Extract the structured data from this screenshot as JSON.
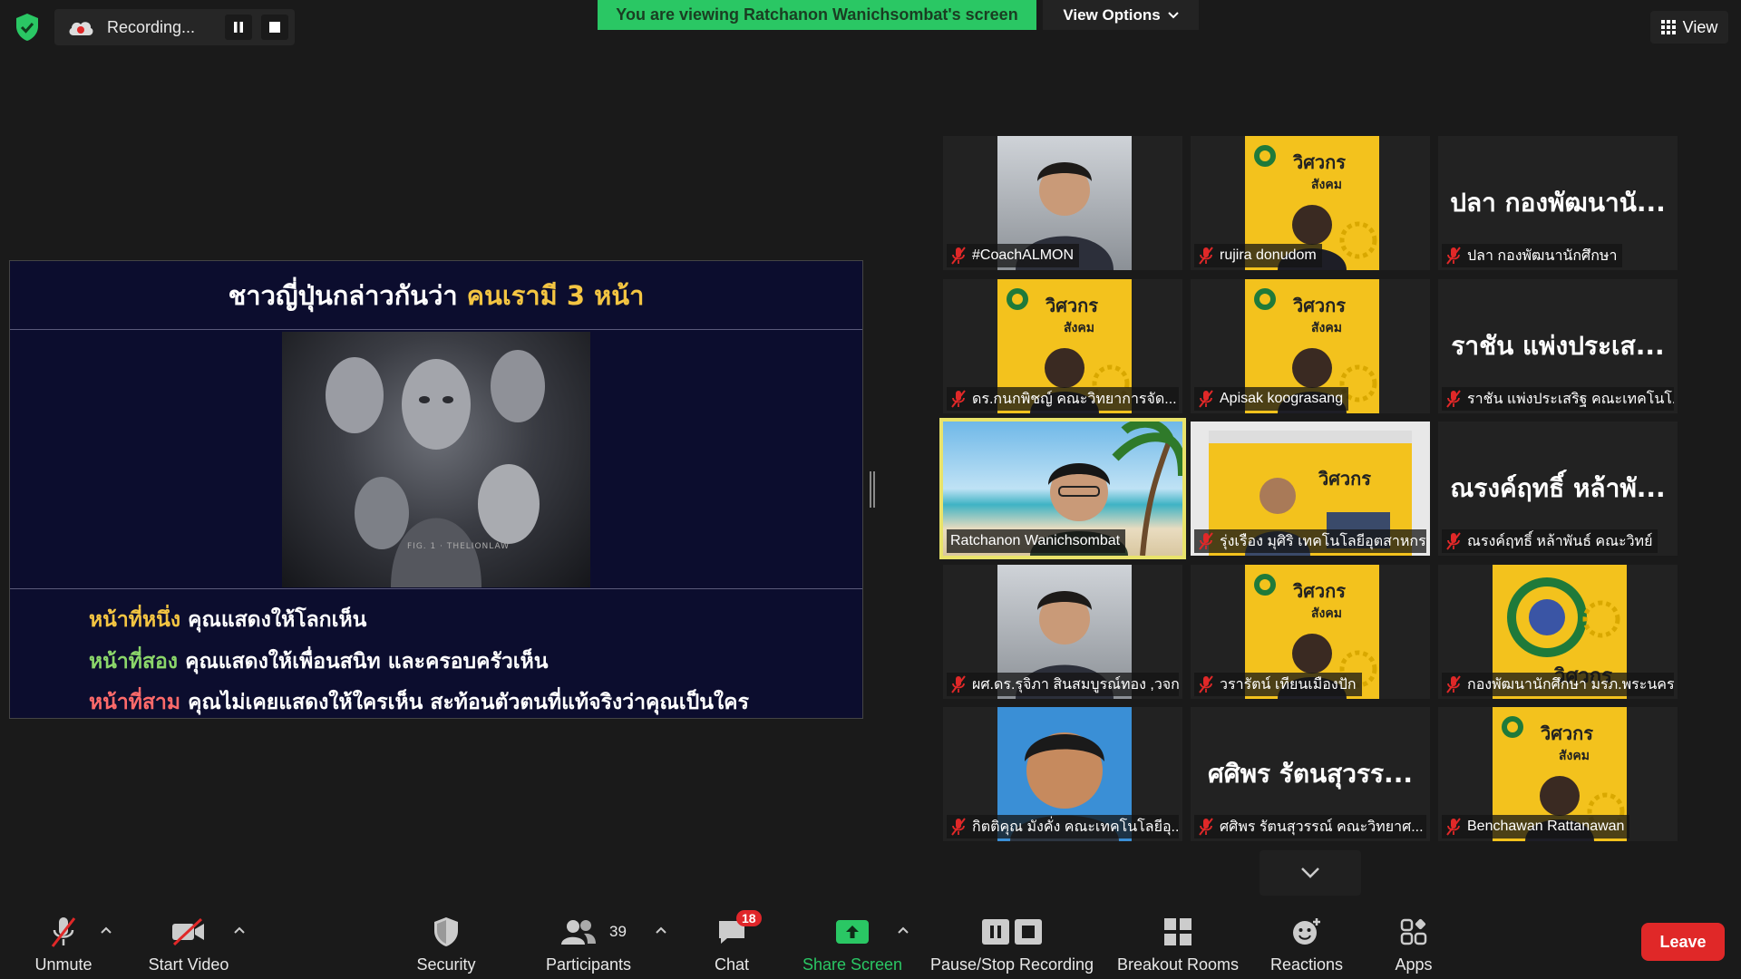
{
  "top_bar": {
    "recording_label": "Recording...",
    "viewing_banner": "You are viewing Ratchanon Wanichsombat's screen",
    "view_options_label": "View Options",
    "view_label": "View"
  },
  "shared_screen": {
    "title_main": "ชาวญี่ปุ่นกล่าวกันว่า",
    "title_highlight": "คนเรามี 3 หน้า",
    "lines": [
      {
        "highlight": "หน้าที่หนึ่ง",
        "text": "คุณแสดงให้โลกเห็น"
      },
      {
        "highlight": "หน้าที่สอง",
        "text": "คุณแสดงให้เพื่อนสนิท และครอบครัวเห็น"
      },
      {
        "highlight": "หน้าที่สาม",
        "text": "คุณไม่เคยแสดงให้ใครเห็น สะท้อนตัวตนที่แท้จริงว่าคุณเป็นใคร"
      }
    ],
    "image_watermark": "FIG. 1 · THELIONLAW"
  },
  "gallery": [
    {
      "name": "#CoachALMON",
      "video": "photo",
      "muted": true
    },
    {
      "name": "rujira donudom",
      "video": "poster",
      "muted": true
    },
    {
      "name": "ปลา กองพัฒนานักศึกษา",
      "big_name": "ปลา กองพัฒนานั...",
      "video": "none",
      "muted": true
    },
    {
      "name": "ดร.กนกพิชญ์ คณะวิทยาการจัด...",
      "video": "poster",
      "muted": true
    },
    {
      "name": "Apisak koograsang",
      "video": "poster",
      "muted": true
    },
    {
      "name": "ราชัน แพ่งประเสริฐ คณะเทคโนโ...",
      "big_name": "ราชัน แพ่งประเส...",
      "video": "none",
      "muted": true
    },
    {
      "name": "Ratchanon Wanichsombat",
      "video": "beach",
      "muted": false,
      "active": true
    },
    {
      "name": "รุ่งเรือง มุศิริ เทคโนโลยีอุตสาหกร...",
      "video": "room",
      "muted": true
    },
    {
      "name": "ณรงค์ฤทธิ์ หล้าพันธ์ คณะวิทย์",
      "big_name": "ณรงค์ฤทธิ์ หล้าพั...",
      "video": "none",
      "muted": true
    },
    {
      "name": "ผศ.ดร.รุจิภา สินสมบูรณ์ทอง ,วจก",
      "video": "photo",
      "muted": true
    },
    {
      "name": "วรารัตน์ เทียนเมืองปัก",
      "video": "poster",
      "muted": true
    },
    {
      "name": "กองพัฒนานักศึกษา มรภ.พระนคร",
      "video": "logo",
      "muted": true
    },
    {
      "name": "กิตติคุณ มังคั่ง คณะเทคโนโลยีอุ...",
      "video": "cartoon",
      "muted": true
    },
    {
      "name": "ศศิพร รัตนสุวรรณ์ คณะวิทยาศ...",
      "big_name": "ศศิพร รัตนสุวรร...",
      "video": "none",
      "muted": true
    },
    {
      "name": "Benchawan Rattanawan",
      "video": "poster",
      "muted": true
    }
  ],
  "poster_text": "วิศวกร สังคม",
  "toolbar": {
    "unmute": "Unmute",
    "start_video": "Start Video",
    "security": "Security",
    "participants": "Participants",
    "participants_count": "39",
    "chat": "Chat",
    "chat_badge": "18",
    "share_screen": "Share Screen",
    "pause_stop_recording": "Pause/Stop Recording",
    "breakout_rooms": "Breakout Rooms",
    "reactions": "Reactions",
    "apps": "Apps",
    "leave": "Leave"
  },
  "colors": {
    "share_green": "#2ac764",
    "leave_red": "#e02828",
    "active_speaker": "#e9e36a",
    "slide_bg": "#0c0d2e",
    "highlight_yellow": "#f4c542"
  }
}
